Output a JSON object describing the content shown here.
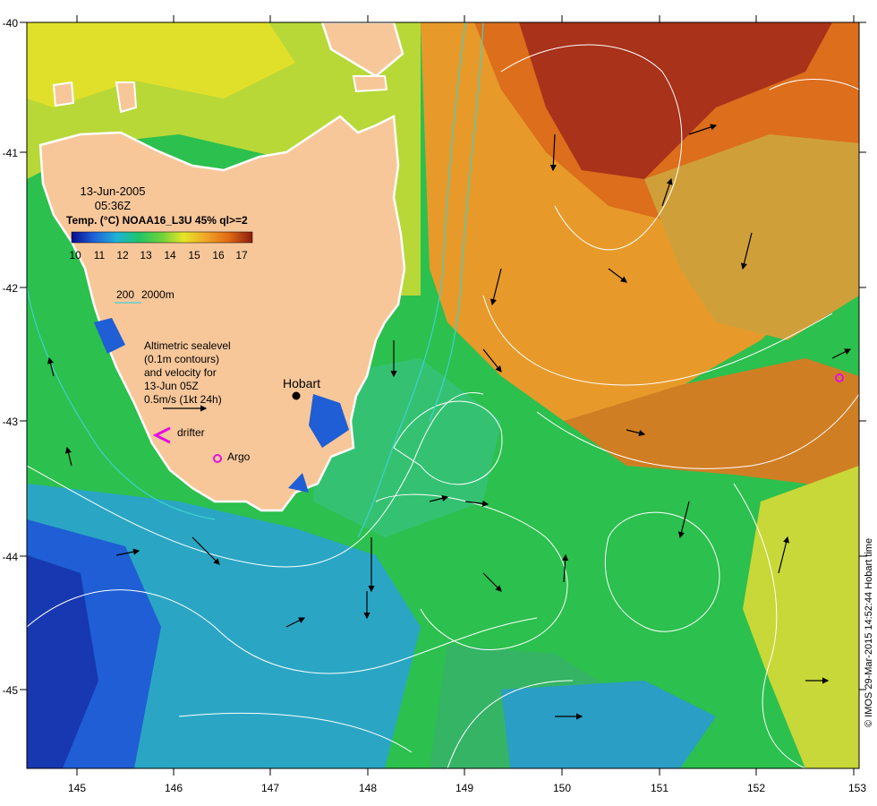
{
  "map": {
    "date": "13-Jun-2005",
    "time": "05:36Z",
    "product": "Temp. (°C) NOAA16_L3U 45% ql>=2",
    "colorbar_ticks": [
      "10",
      "11",
      "12",
      "13",
      "14",
      "15",
      "16",
      "17"
    ],
    "colorbar_colors": [
      "#0a0a8c",
      "#1e5fd8",
      "#1fb3d6",
      "#1fc46a",
      "#6fd23a",
      "#e6e626",
      "#f0a226",
      "#e06a14",
      "#8c1c0c"
    ],
    "depth_legend": {
      "label_200": "200",
      "label_2000": "2000m"
    },
    "altimetry_note": [
      "Altimetric sealevel",
      "(0.1m contours)",
      "and velocity for",
      "13-Jun 05Z",
      "0.5m/s (1kt 24h)"
    ],
    "drifter_label": "drifter",
    "argo_label": "Argo",
    "place_label": "Hobart",
    "x_ticks": [
      "145",
      "146",
      "147",
      "148",
      "149",
      "150",
      "151",
      "152",
      "153"
    ],
    "y_ticks": [
      "-40",
      "-41",
      "-42",
      "-43",
      "-44",
      "-45"
    ],
    "credit": "© IMOS 29-Mar-2015 14:52:44 Hobart time",
    "colors": {
      "land": "#f7c79a",
      "drifter": "#e010e0",
      "argo": "#e010e0",
      "contour": "#ffffff",
      "isobath": "#40d0d0"
    }
  }
}
